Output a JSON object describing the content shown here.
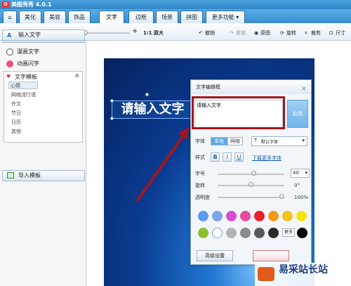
{
  "app": {
    "title": "美图秀秀 4.0.1",
    "logo_glyph": "✿"
  },
  "tabs": {
    "home_glyph": "⌂",
    "items": [
      "美化",
      "美容",
      "饰品",
      "文字",
      "边框",
      "场景",
      "拼图",
      "更多功能 ▾"
    ],
    "active": "文字"
  },
  "toolbar": {
    "zoom_out_glyph": "−",
    "zoom_in_glyph": "+",
    "original_size": "1:1 原大",
    "undo": "撤销",
    "redo": "重做",
    "original_image": "原图",
    "rotate": "旋转",
    "crop": "裁剪",
    "size": "尺寸"
  },
  "sidebar": {
    "input_text_button": "输入文字",
    "comic_text": "漫画文字",
    "animated_flash": "动画闪字",
    "template_header": "文字模板",
    "templates": [
      "心情",
      "网络流行语",
      "外文",
      "节日",
      "日历",
      "其他"
    ],
    "selected_template": "心情",
    "import_template_button": "导入模板"
  },
  "canvas": {
    "sample_text": "请输入文字"
  },
  "dialog": {
    "title": "文字编辑框",
    "input_value": "请输入文字",
    "apply_button": "应用",
    "font_label": "字体",
    "font_local": "本地",
    "font_web": "网络",
    "font_selected": "默认字体",
    "style_label": "样式",
    "bold": "B",
    "italic": "I",
    "underline": "U",
    "download_fonts": "下载更多字体",
    "size_label": "字号",
    "size_value": "40",
    "size_level": 0.55,
    "rotate_label": "旋转",
    "rotate_value": "0°",
    "rotate_level": 0.5,
    "opacity_label": "透明度",
    "opacity_value": "100%",
    "opacity_level": 1.0,
    "colors_row1": [
      "#5b9bef",
      "#7aa5e8",
      "#d94bd5",
      "#e94a9a",
      "#e8202a",
      "#f39a1c",
      "#f6c21b",
      "#f4e40e"
    ],
    "colors_row2": [
      "#8bc02f",
      "#ffffff",
      "#b4b4b4",
      "#8a8a8a",
      "#5a5a5a",
      "#2b2b2b"
    ],
    "more_colors": "更多",
    "last_color": "#000000",
    "advanced_button": "高级设置"
  },
  "watermark": {
    "site": "易采站长站"
  }
}
